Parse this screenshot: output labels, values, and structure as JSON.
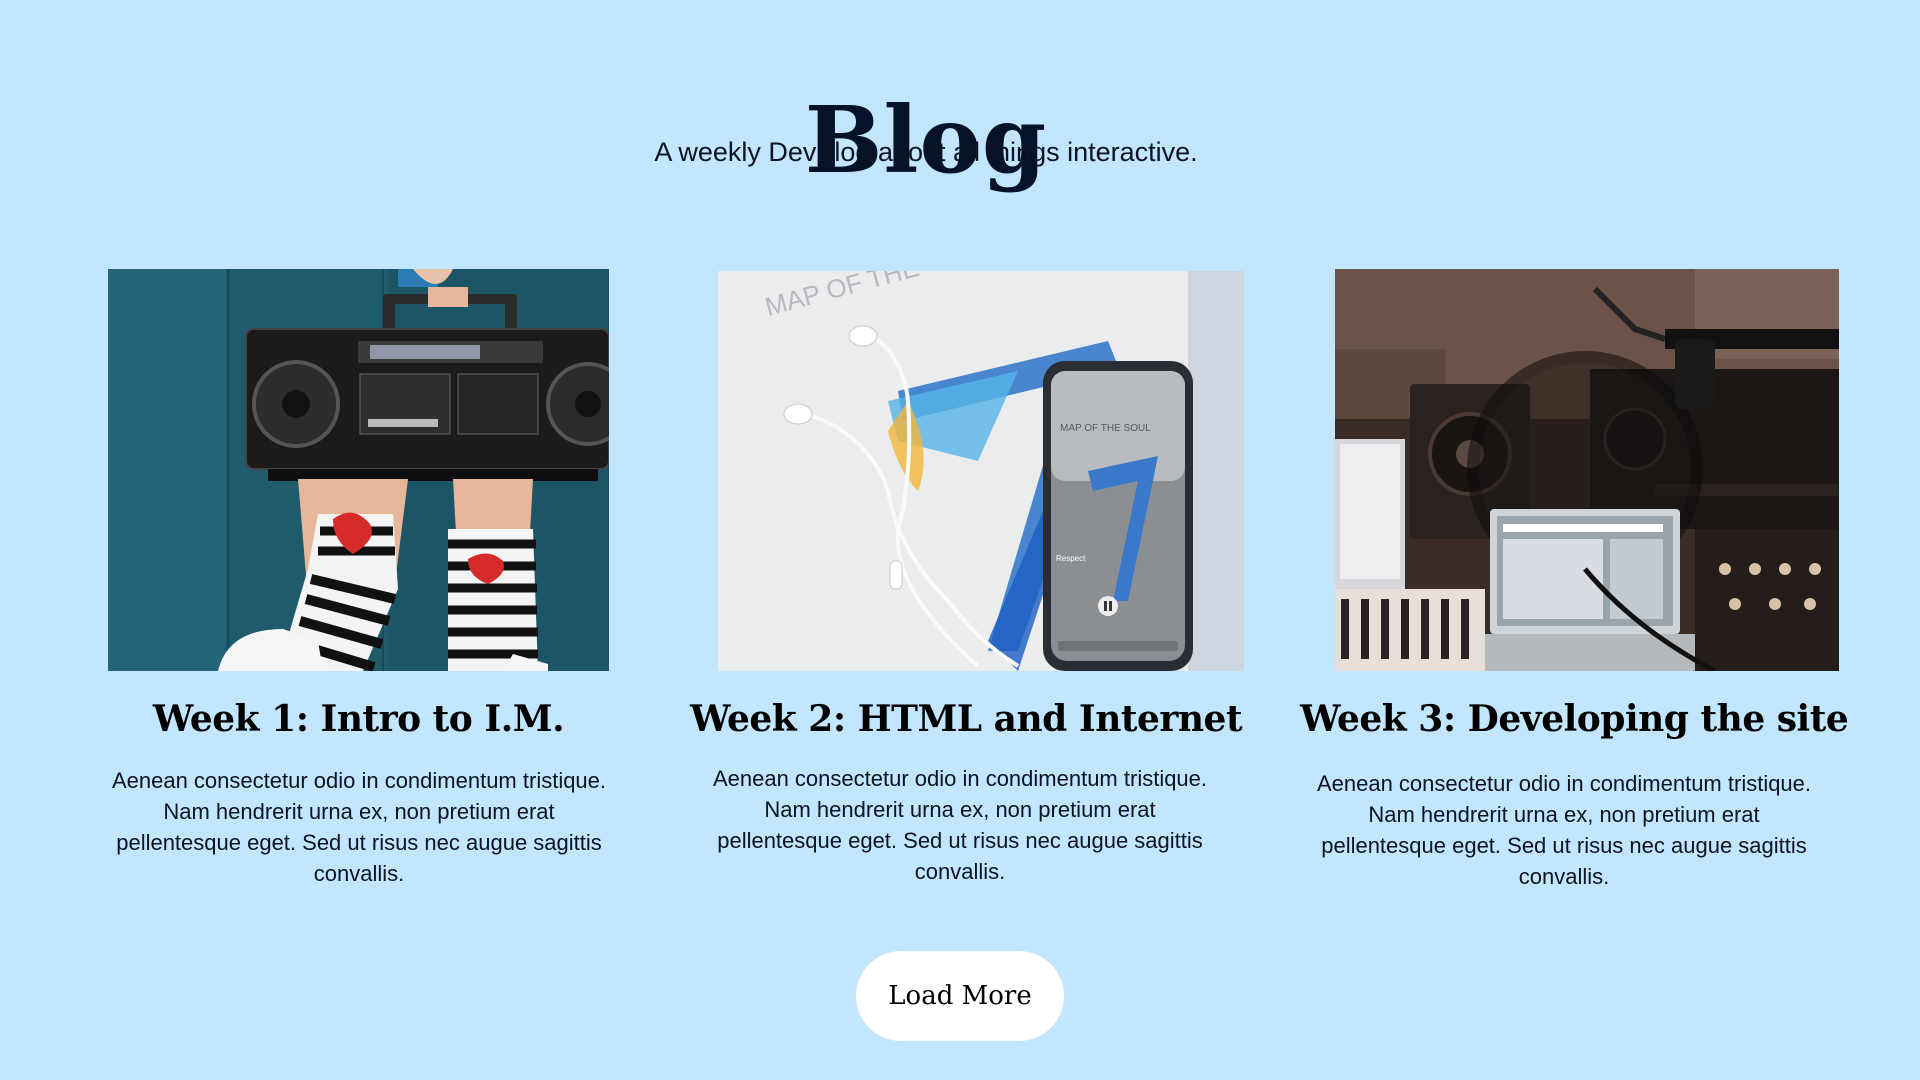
{
  "header": {
    "title": "Blog",
    "subtitle": "A weekly DevBlog about all things interactive."
  },
  "posts": [
    {
      "image_icon": "boombox-photo",
      "title": "Week 1: Intro to I.M.",
      "excerpt": "Aenean consectetur odio in condimentum tristique. Nam hendrerit urna ex, non pretium erat pellentesque eget. Sed ut risus nec augue sagittis convallis."
    },
    {
      "image_icon": "phone-earphones-photo",
      "title": "Week 2:  HTML and Internet",
      "excerpt": "Aenean consectetur odio in condimentum tristique. Nam hendrerit urna ex, non pretium erat pellentesque eget. Sed ut risus nec augue sagittis convallis."
    },
    {
      "image_icon": "recording-studio-photo",
      "title": "Week 3: Developing the site",
      "excerpt": "Aenean consectetur odio in condimentum tristique. Nam hendrerit urna ex, non pretium erat pellentesque eget. Sed ut risus nec augue sagittis convallis."
    }
  ],
  "load_more_label": "Load More",
  "colors": {
    "background": "#c2e6fd",
    "button": "#ffffff",
    "heading": "#061228"
  }
}
